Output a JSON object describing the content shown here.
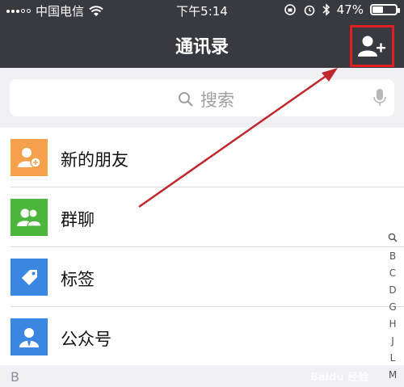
{
  "status_bar": {
    "carrier": "中国电信",
    "time": "下午5:14",
    "battery": "47%",
    "battery_level": 0.47
  },
  "header": {
    "title": "通讯录"
  },
  "search": {
    "placeholder": "搜索"
  },
  "list_items": [
    {
      "label": "新的朋友",
      "icon": "add-friend-icon",
      "color": "#f5a04b"
    },
    {
      "label": "群聊",
      "icon": "group-chat-icon",
      "color": "#4cb53c"
    },
    {
      "label": "标签",
      "icon": "tag-icon",
      "color": "#3b86e0"
    },
    {
      "label": "公众号",
      "icon": "official-account-icon",
      "color": "#3b86e0"
    }
  ],
  "section_header": "B",
  "index_letters": [
    "B",
    "C",
    "D",
    "G",
    "H",
    "J",
    "L",
    "M"
  ],
  "colors": {
    "header_bg": "#393a3f",
    "highlight": "#e02020"
  }
}
